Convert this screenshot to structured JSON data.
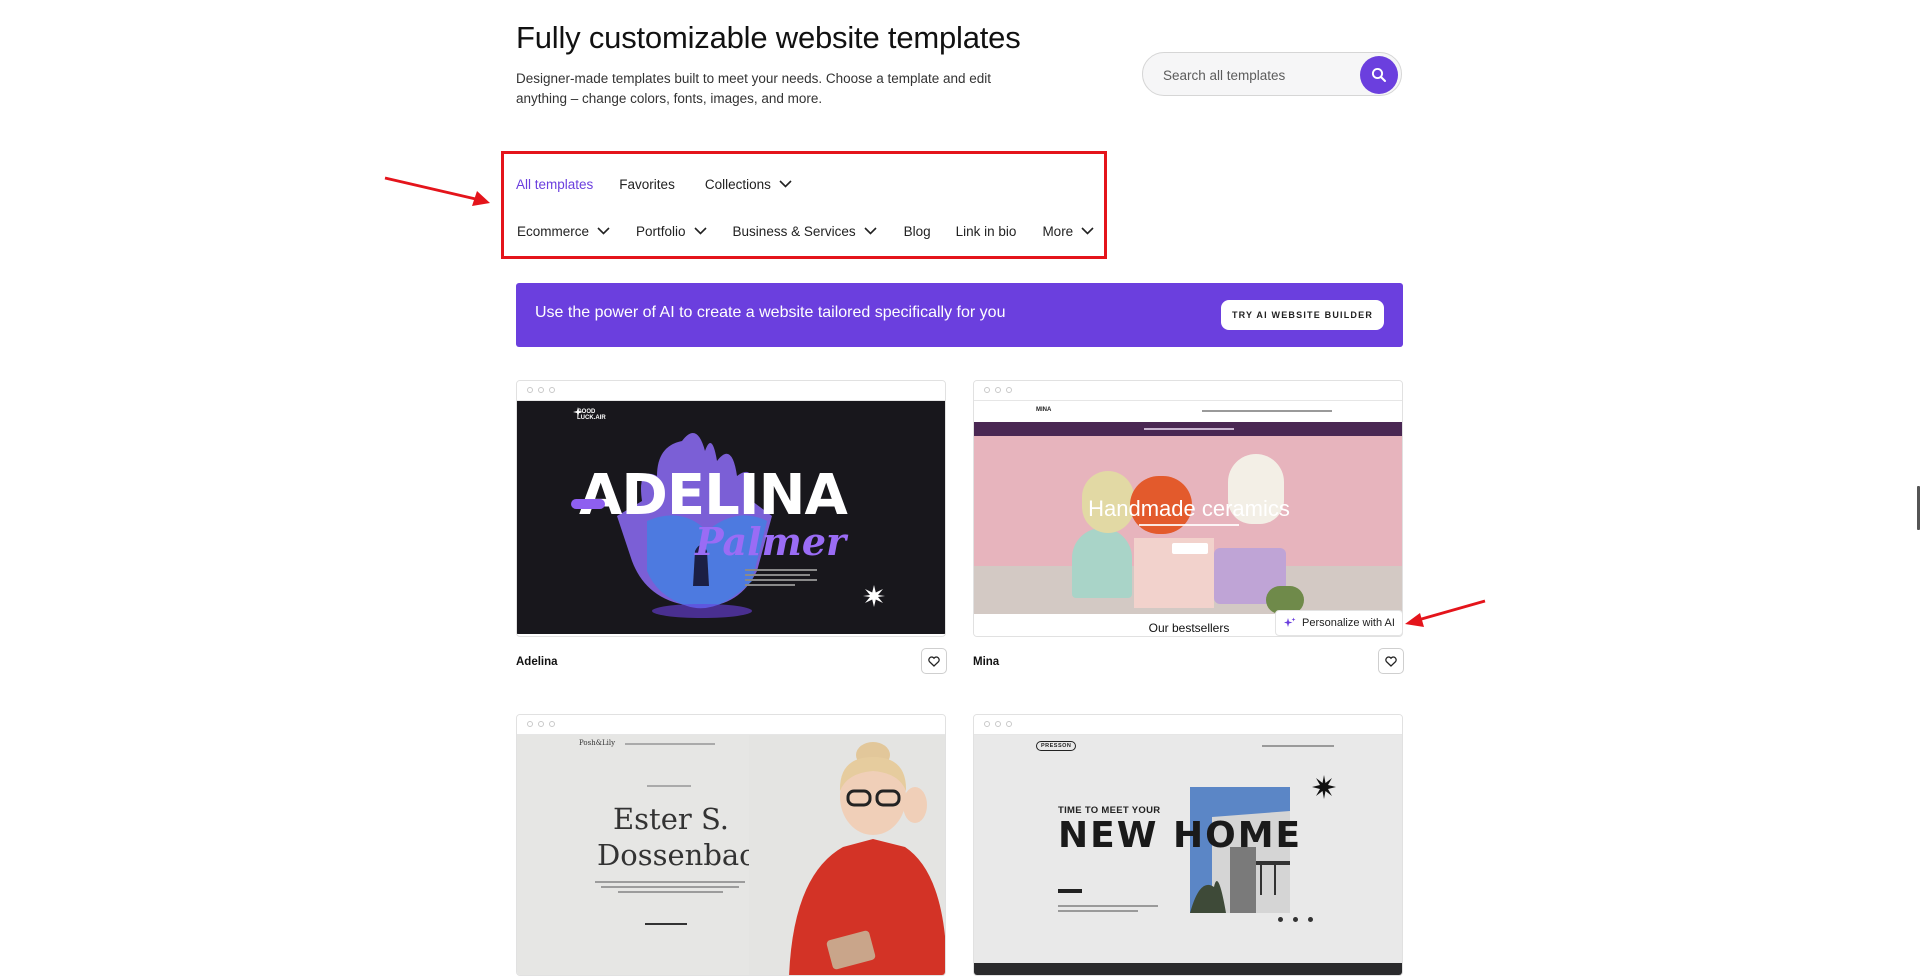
{
  "header": {
    "title": "Fully customizable website templates",
    "subtitle": "Designer-made templates built to meet your needs. Choose a template and edit anything – change colors, fonts, images, and more."
  },
  "search": {
    "placeholder": "Search all templates",
    "icon": "search-icon"
  },
  "nav": {
    "row1": [
      "All templates",
      "Favorites",
      "Collections"
    ],
    "row2": [
      "Ecommerce",
      "Portfolio",
      "Business & Services",
      "Blog",
      "Link in bio",
      "More"
    ],
    "active": "All templates"
  },
  "banner": {
    "text": "Use the power of AI to create a website tailored specifically for you",
    "cta": "TRY AI WEBSITE BUILDER"
  },
  "cards": [
    {
      "name": "Adelina",
      "preview": {
        "brand": "GOOD LUCK.AIR",
        "headline": "ADELINA",
        "script": "Palmer"
      }
    },
    {
      "name": "Mina",
      "preview": {
        "brand": "MINA",
        "headline": "Handmade ceramics",
        "section": "Our bestsellers"
      }
    },
    {
      "name": "",
      "preview": {
        "brand": "Posh&Lily",
        "headline_1": "Ester S.",
        "headline_2": "Dossenbach"
      }
    },
    {
      "name": "",
      "preview": {
        "brand": "PRESSON",
        "kicker": "TIME TO MEET YOUR",
        "headline": "NEW HOME"
      }
    }
  ],
  "personalize": {
    "label": "Personalize with AI"
  },
  "colors": {
    "accent": "#6b3fde",
    "highlight": "#e4141b"
  }
}
